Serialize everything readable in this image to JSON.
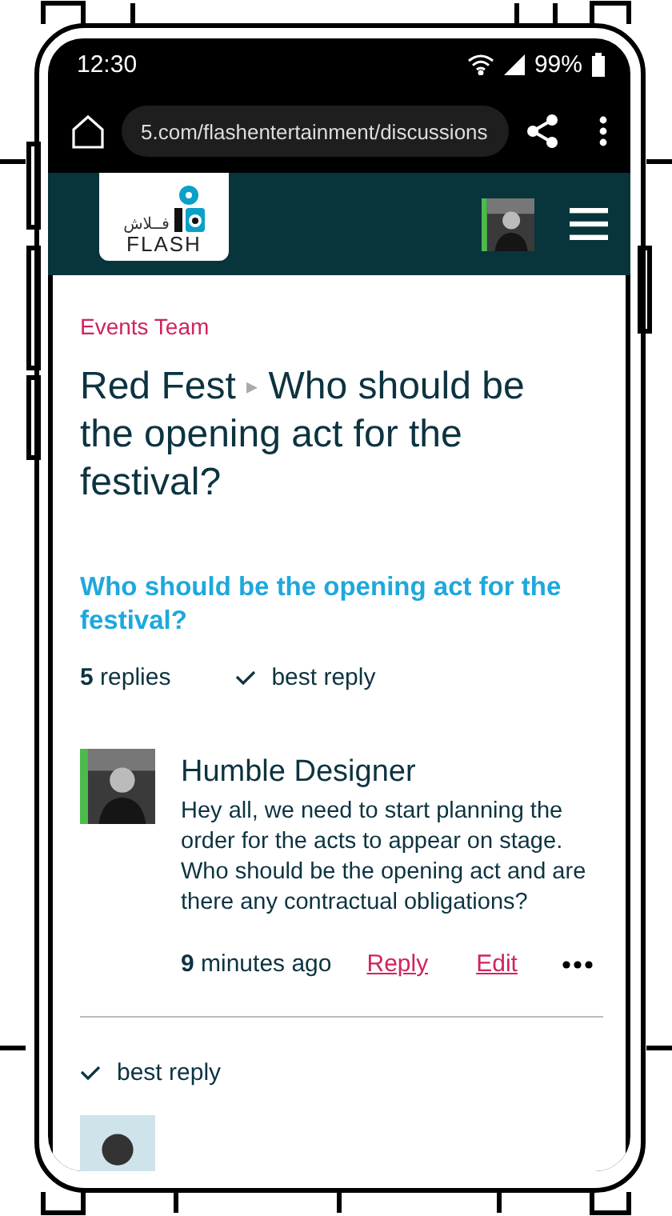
{
  "status_bar": {
    "time": "12:30",
    "battery": "99%"
  },
  "browser": {
    "url": "5.com/flashentertainment/discussions"
  },
  "header": {
    "logo_arabic": "فــلاش",
    "logo_text": "FLASH"
  },
  "breadcrumb": {
    "group": "Events Team",
    "parent": "Red Fest",
    "separator": "▸",
    "title": "Who should be the opening act for the festival?"
  },
  "topic": {
    "title": "Who should be the opening act for the festival?",
    "replies": "**5** replies",
    "best_reply": "best reply"
  },
  "posts": [
    {
      "author": "Humble Designer",
      "body": "Hey all, we need to start planning the order for the acts to appear on stage. Who should be the opening act and are there any contractual obligations?",
      "time": "**9** minutes ago",
      "actions": [
        "Reply",
        "Edit"
      ]
    }
  ],
  "next": {
    "best_reply": "best reply"
  }
}
